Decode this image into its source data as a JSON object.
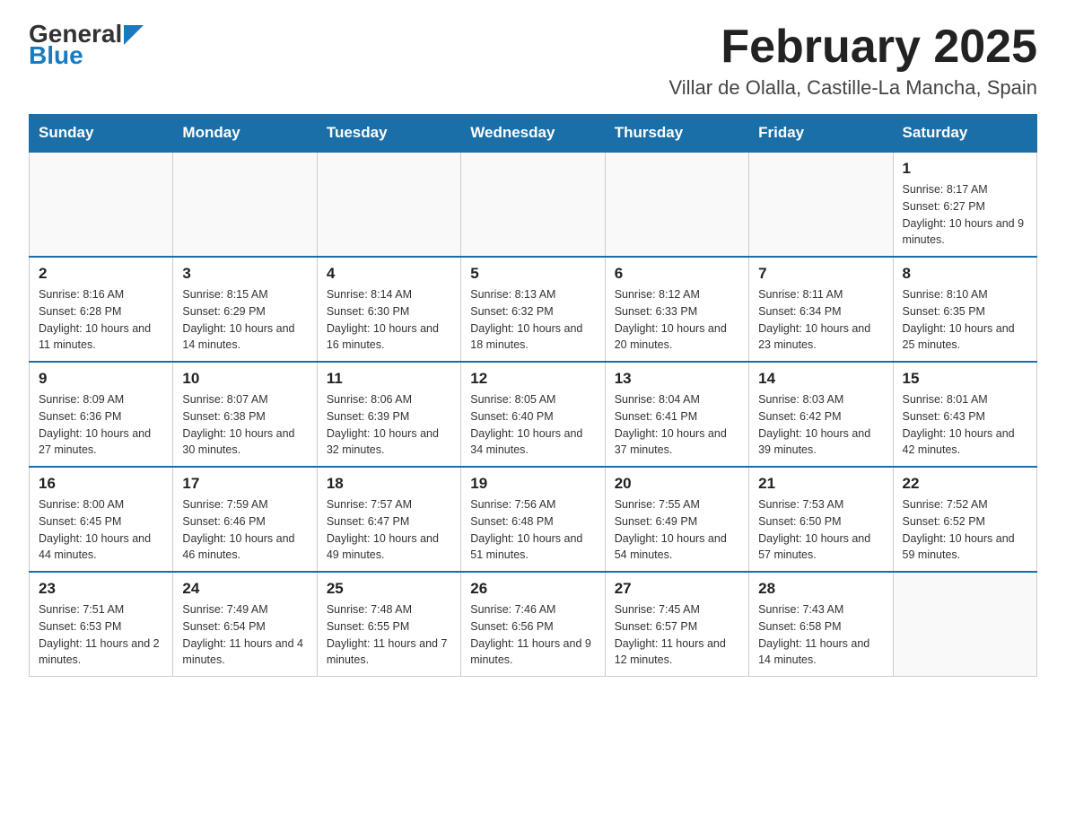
{
  "logo": {
    "part1": "General",
    "part2": "Blue"
  },
  "title": "February 2025",
  "subtitle": "Villar de Olalla, Castille-La Mancha, Spain",
  "days_of_week": [
    "Sunday",
    "Monday",
    "Tuesday",
    "Wednesday",
    "Thursday",
    "Friday",
    "Saturday"
  ],
  "weeks": [
    [
      {
        "date": "",
        "info": ""
      },
      {
        "date": "",
        "info": ""
      },
      {
        "date": "",
        "info": ""
      },
      {
        "date": "",
        "info": ""
      },
      {
        "date": "",
        "info": ""
      },
      {
        "date": "",
        "info": ""
      },
      {
        "date": "1",
        "info": "Sunrise: 8:17 AM\nSunset: 6:27 PM\nDaylight: 10 hours and 9 minutes."
      }
    ],
    [
      {
        "date": "2",
        "info": "Sunrise: 8:16 AM\nSunset: 6:28 PM\nDaylight: 10 hours and 11 minutes."
      },
      {
        "date": "3",
        "info": "Sunrise: 8:15 AM\nSunset: 6:29 PM\nDaylight: 10 hours and 14 minutes."
      },
      {
        "date": "4",
        "info": "Sunrise: 8:14 AM\nSunset: 6:30 PM\nDaylight: 10 hours and 16 minutes."
      },
      {
        "date": "5",
        "info": "Sunrise: 8:13 AM\nSunset: 6:32 PM\nDaylight: 10 hours and 18 minutes."
      },
      {
        "date": "6",
        "info": "Sunrise: 8:12 AM\nSunset: 6:33 PM\nDaylight: 10 hours and 20 minutes."
      },
      {
        "date": "7",
        "info": "Sunrise: 8:11 AM\nSunset: 6:34 PM\nDaylight: 10 hours and 23 minutes."
      },
      {
        "date": "8",
        "info": "Sunrise: 8:10 AM\nSunset: 6:35 PM\nDaylight: 10 hours and 25 minutes."
      }
    ],
    [
      {
        "date": "9",
        "info": "Sunrise: 8:09 AM\nSunset: 6:36 PM\nDaylight: 10 hours and 27 minutes."
      },
      {
        "date": "10",
        "info": "Sunrise: 8:07 AM\nSunset: 6:38 PM\nDaylight: 10 hours and 30 minutes."
      },
      {
        "date": "11",
        "info": "Sunrise: 8:06 AM\nSunset: 6:39 PM\nDaylight: 10 hours and 32 minutes."
      },
      {
        "date": "12",
        "info": "Sunrise: 8:05 AM\nSunset: 6:40 PM\nDaylight: 10 hours and 34 minutes."
      },
      {
        "date": "13",
        "info": "Sunrise: 8:04 AM\nSunset: 6:41 PM\nDaylight: 10 hours and 37 minutes."
      },
      {
        "date": "14",
        "info": "Sunrise: 8:03 AM\nSunset: 6:42 PM\nDaylight: 10 hours and 39 minutes."
      },
      {
        "date": "15",
        "info": "Sunrise: 8:01 AM\nSunset: 6:43 PM\nDaylight: 10 hours and 42 minutes."
      }
    ],
    [
      {
        "date": "16",
        "info": "Sunrise: 8:00 AM\nSunset: 6:45 PM\nDaylight: 10 hours and 44 minutes."
      },
      {
        "date": "17",
        "info": "Sunrise: 7:59 AM\nSunset: 6:46 PM\nDaylight: 10 hours and 46 minutes."
      },
      {
        "date": "18",
        "info": "Sunrise: 7:57 AM\nSunset: 6:47 PM\nDaylight: 10 hours and 49 minutes."
      },
      {
        "date": "19",
        "info": "Sunrise: 7:56 AM\nSunset: 6:48 PM\nDaylight: 10 hours and 51 minutes."
      },
      {
        "date": "20",
        "info": "Sunrise: 7:55 AM\nSunset: 6:49 PM\nDaylight: 10 hours and 54 minutes."
      },
      {
        "date": "21",
        "info": "Sunrise: 7:53 AM\nSunset: 6:50 PM\nDaylight: 10 hours and 57 minutes."
      },
      {
        "date": "22",
        "info": "Sunrise: 7:52 AM\nSunset: 6:52 PM\nDaylight: 10 hours and 59 minutes."
      }
    ],
    [
      {
        "date": "23",
        "info": "Sunrise: 7:51 AM\nSunset: 6:53 PM\nDaylight: 11 hours and 2 minutes."
      },
      {
        "date": "24",
        "info": "Sunrise: 7:49 AM\nSunset: 6:54 PM\nDaylight: 11 hours and 4 minutes."
      },
      {
        "date": "25",
        "info": "Sunrise: 7:48 AM\nSunset: 6:55 PM\nDaylight: 11 hours and 7 minutes."
      },
      {
        "date": "26",
        "info": "Sunrise: 7:46 AM\nSunset: 6:56 PM\nDaylight: 11 hours and 9 minutes."
      },
      {
        "date": "27",
        "info": "Sunrise: 7:45 AM\nSunset: 6:57 PM\nDaylight: 11 hours and 12 minutes."
      },
      {
        "date": "28",
        "info": "Sunrise: 7:43 AM\nSunset: 6:58 PM\nDaylight: 11 hours and 14 minutes."
      },
      {
        "date": "",
        "info": ""
      }
    ]
  ]
}
